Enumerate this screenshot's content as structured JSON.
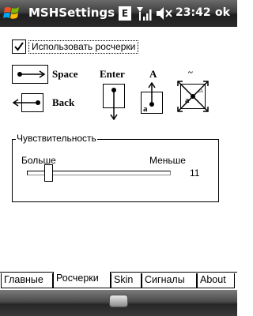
{
  "status_bar": {
    "app_title": "MSHSettings",
    "edge_badge": "E",
    "clock": "23:42",
    "ok_label": "ok"
  },
  "content": {
    "use_strokes_checkbox": {
      "label": "Использовать росчерки",
      "checked": true
    },
    "gestures": {
      "space_label": "Space",
      "back_label": "Back",
      "enter_label": "Enter",
      "shift_label": "A",
      "caps_mark": "~"
    },
    "sensitivity": {
      "title": "Чувствительность",
      "more_label": "Больше",
      "less_label": "Меньше",
      "value": "11"
    }
  },
  "tabs": [
    {
      "label": "Главные",
      "active": false
    },
    {
      "label": "Росчерки",
      "active": true
    },
    {
      "label": "Skin",
      "active": false
    },
    {
      "label": "Сигналы",
      "active": false
    },
    {
      "label": "About",
      "active": false
    }
  ]
}
